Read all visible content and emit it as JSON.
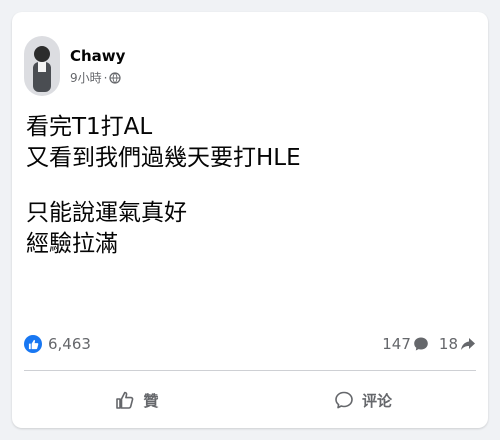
{
  "post": {
    "author": "Chawy",
    "time": "9小時",
    "separator": "·",
    "privacy_icon": "globe-icon",
    "lines_block1": [
      "看完T1打AL",
      "又看到我們過幾天要打HLE"
    ],
    "lines_block2": [
      "只能說運氣真好",
      "經驗拉滿"
    ]
  },
  "stats": {
    "reactions_count": "6,463",
    "reaction_icon": "like-icon",
    "comments_count": "147",
    "comment_icon": "comment-bubble-icon",
    "shares_count": "18",
    "share_icon": "share-arrow-icon"
  },
  "actions": {
    "like_label": "贊",
    "like_icon": "thumbs-up-icon",
    "comment_label": "评论",
    "comment_icon": "comment-icon"
  },
  "colors": {
    "brand_blue": "#1877f2",
    "text_primary": "#050505",
    "text_secondary": "#65676b"
  }
}
